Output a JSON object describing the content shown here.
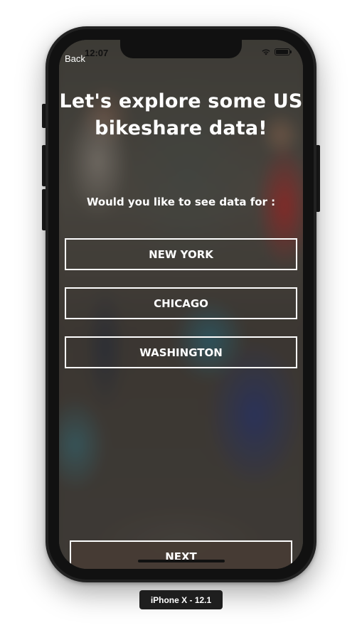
{
  "status_bar": {
    "time": "12:07",
    "wifi_icon": "wifi-icon",
    "battery_icon": "battery-icon"
  },
  "nav": {
    "back_label": "Back"
  },
  "main": {
    "title_line1": "Let's explore some US",
    "title_line2": "bikeshare data!",
    "prompt": "Would you like to see data for :",
    "cities": [
      {
        "label": "NEW YORK"
      },
      {
        "label": "CHICAGO"
      },
      {
        "label": "WASHINGTON"
      }
    ],
    "next_label": "NEXT"
  },
  "simulator": {
    "device_label": "iPhone X - 12.1"
  },
  "colors": {
    "text": "#ffffff",
    "button_border": "#ffffff",
    "next_button_bg": "#463c34",
    "phone_body": "#222222"
  }
}
